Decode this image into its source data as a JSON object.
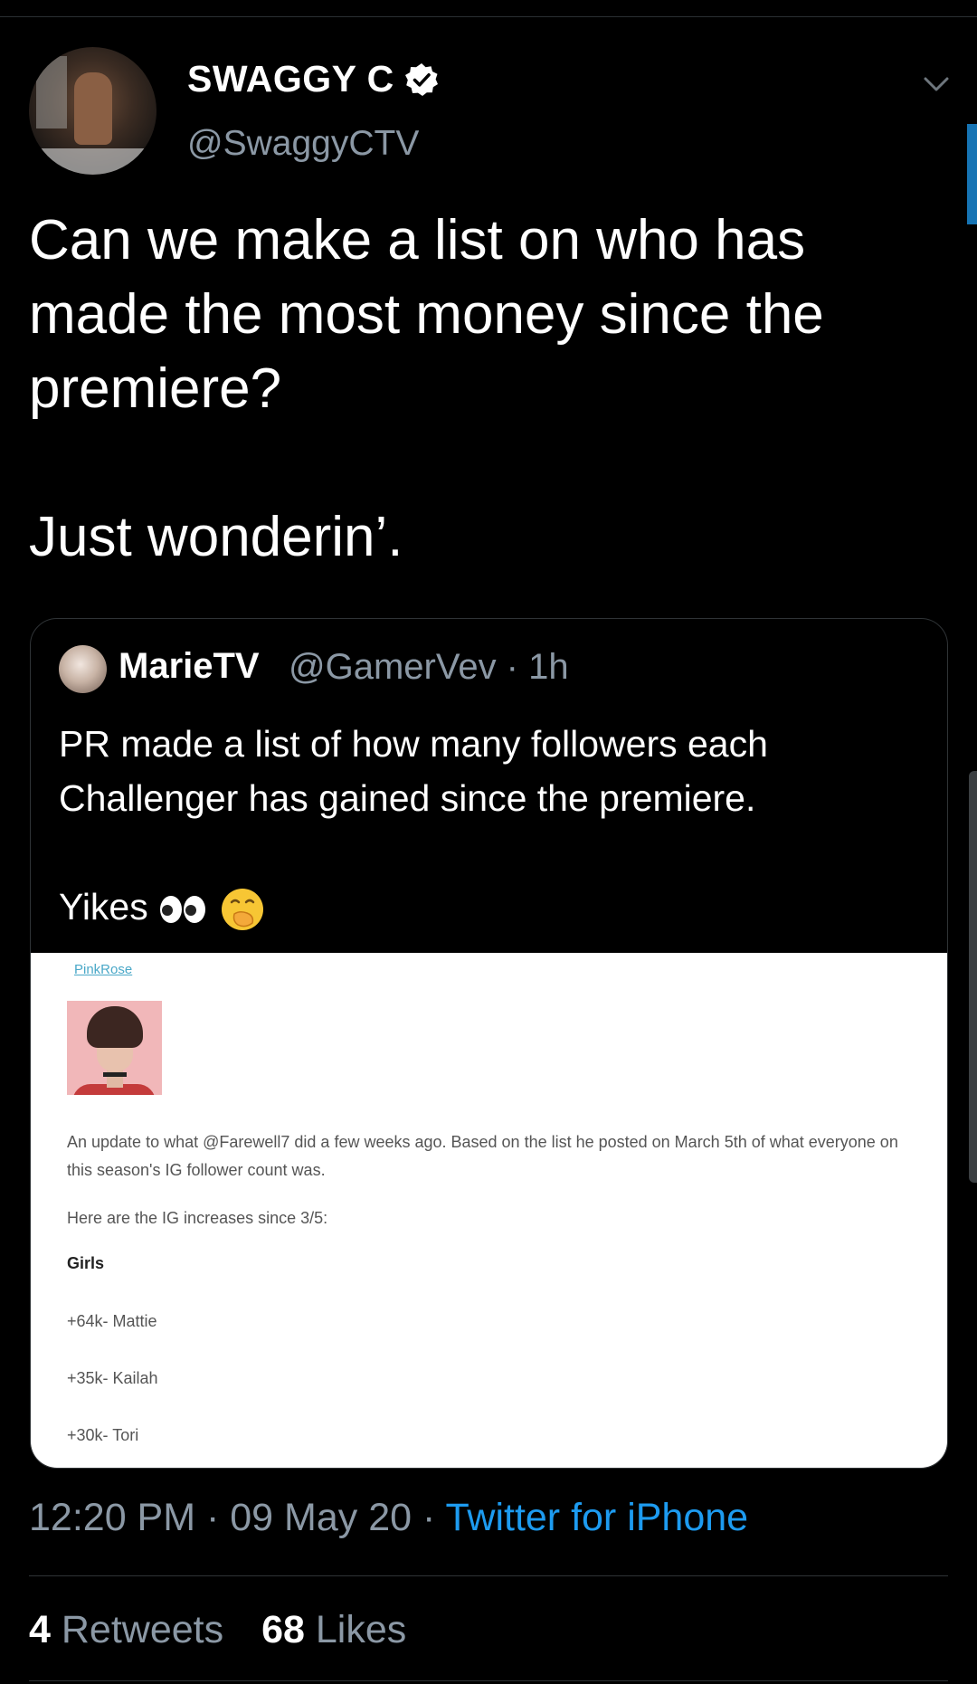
{
  "tweet": {
    "display_name": "SWAGGY C",
    "handle": "@SwaggyCTV",
    "text_line1": "Can we make a list on who has made the most money since the premiere?",
    "text_line2": "Just wonderin’."
  },
  "quoted_tweet": {
    "display_name": "MarieTV",
    "meta": "@GamerVev · 1h",
    "text_line1": "PR made a list of how many followers each Challenger has gained since the premiere.",
    "text_line2": "Yikes",
    "emoji": [
      "eyes-icon",
      "hand-over-mouth-icon"
    ],
    "image": {
      "username": "PinkRose",
      "paragraph1": "An update to what @Farewell7 did a few weeks ago. Based on the list he posted on March 5th of what everyone on this season's IG follower count was.",
      "paragraph2": "Here are the IG increases since 3/5:",
      "heading": "Girls",
      "items": [
        "+64k- Mattie",
        "+35k- Kailah",
        "+30k- Tori"
      ]
    }
  },
  "meta": {
    "time": "12:20 PM · 09 May 20 · ",
    "source": "Twitter for iPhone"
  },
  "stats": {
    "retweets_count": "4",
    "retweets_label": "Retweets",
    "likes_count": "68",
    "likes_label": "Likes"
  },
  "colors": {
    "background": "#000000",
    "secondary_text": "#8b98a5",
    "link": "#1d9bf0",
    "divider": "#2f3336"
  }
}
